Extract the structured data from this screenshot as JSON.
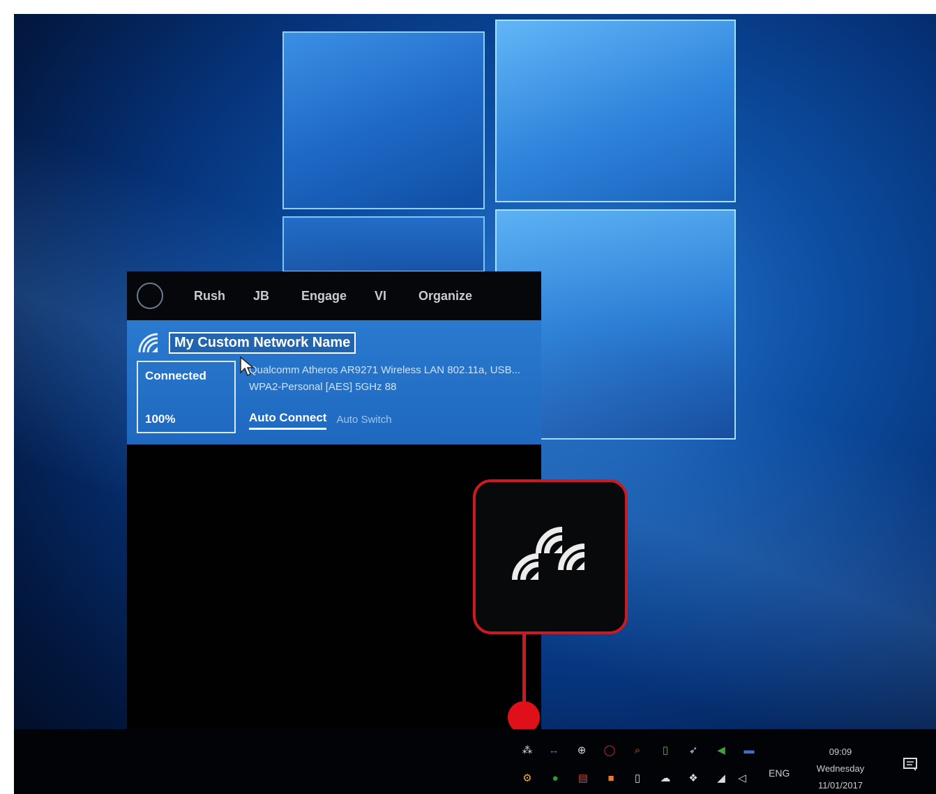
{
  "flyout": {
    "bar_items": [
      "Rush",
      "JB",
      "Engage",
      "VI",
      "Organize"
    ],
    "network_name": "My Custom Network Name",
    "status": "Connected",
    "signal": "100%",
    "adapter_line1": "Qualcomm Atheros AR9271 Wireless LAN 802.11a, USB...",
    "adapter_line2": "WPA2-Personal [AES] 5GHz 88",
    "tab_auto_connect": "Auto Connect",
    "tab_auto_switch": "Auto Switch"
  },
  "callout": {
    "icon": "wifi-networks-icon",
    "accent": "#cc1a22"
  },
  "taskbar": {
    "language": "ENG",
    "time": "09:09",
    "day": "Wednesday",
    "date": "11/01/2017",
    "tray_icons_top": [
      "network-icon",
      "arrows-icon",
      "globe-icon",
      "red-circle-icon",
      "search-icon",
      "phone-icon",
      "rocket-icon",
      "green-arrow-icon",
      "flag-icon"
    ],
    "tray_icons_bottom": [
      "gear-icon",
      "green-circle-icon",
      "document-icon",
      "orange-box-icon",
      "usb-icon",
      "cloud-icon",
      "dropbox-icon",
      "wifi-icon",
      "speaker-icon"
    ]
  }
}
